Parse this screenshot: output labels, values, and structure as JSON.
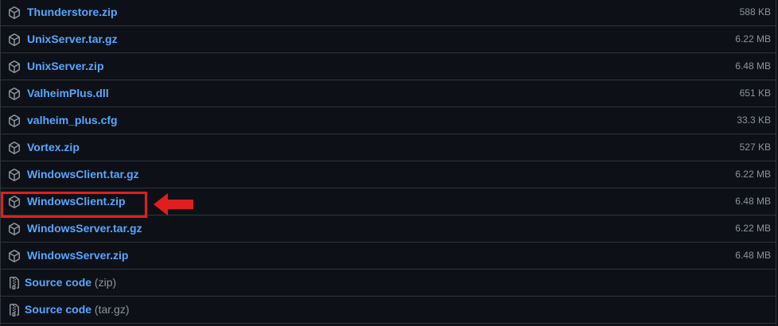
{
  "assets": [
    {
      "name": "Thunderstore.zip",
      "size": "588 KB",
      "icon": "package-icon"
    },
    {
      "name": "UnixServer.tar.gz",
      "size": "6.22 MB",
      "icon": "package-icon"
    },
    {
      "name": "UnixServer.zip",
      "size": "6.48 MB",
      "icon": "package-icon"
    },
    {
      "name": "ValheimPlus.dll",
      "size": "651 KB",
      "icon": "package-icon"
    },
    {
      "name": "valheim_plus.cfg",
      "size": "33.3 KB",
      "icon": "package-icon"
    },
    {
      "name": "Vortex.zip",
      "size": "527 KB",
      "icon": "package-icon"
    },
    {
      "name": "WindowsClient.tar.gz",
      "size": "6.22 MB",
      "icon": "package-icon"
    },
    {
      "name": "WindowsClient.zip",
      "size": "6.48 MB",
      "icon": "package-icon",
      "highlighted": true
    },
    {
      "name": "WindowsServer.tar.gz",
      "size": "6.22 MB",
      "icon": "package-icon"
    },
    {
      "name": "WindowsServer.zip",
      "size": "6.48 MB",
      "icon": "package-icon"
    }
  ],
  "source_code": [
    {
      "label": "Source code",
      "suffix": "(zip)",
      "icon": "file-zip-icon"
    },
    {
      "label": "Source code",
      "suffix": "(tar.gz)",
      "icon": "file-zip-icon"
    }
  ],
  "colors": {
    "background": "#0d1117",
    "border": "#30363d",
    "link": "#58a6ff",
    "muted": "#8b949e",
    "highlight": "#e01e1e"
  }
}
